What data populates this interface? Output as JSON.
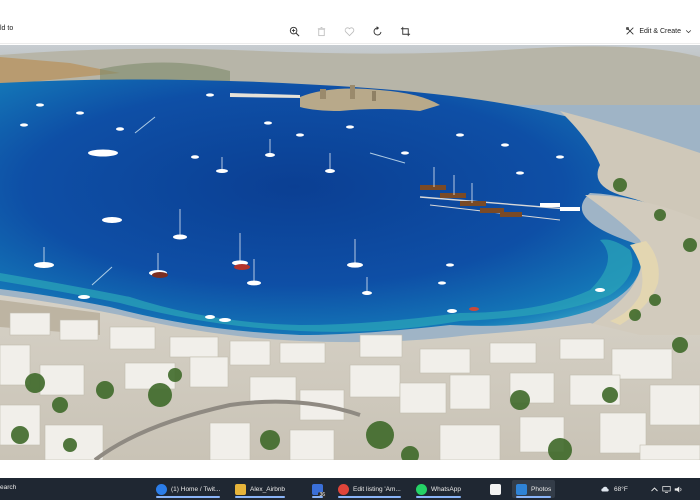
{
  "toolbar": {
    "left_label": "ld to",
    "edit_create_label": "Edit & Create",
    "icons": [
      "zoom-in-icon",
      "delete-icon",
      "favorite-icon",
      "rotate-icon",
      "crop-icon"
    ]
  },
  "photo": {
    "description_icon": "photo-image"
  },
  "taskbar": {
    "search_label": "earch",
    "apps": [
      {
        "label": "(1) Home / Twit..."
      },
      {
        "label": "Alex_Airbnb"
      },
      {
        "label": "36"
      },
      {
        "label": "Edit listing 'Am..."
      },
      {
        "label": "WhatsApp"
      },
      {
        "label": ""
      },
      {
        "label": "Photos"
      }
    ],
    "weather": "68°F",
    "colors": {
      "bg": "#1f2732",
      "active": "#8ab4f8"
    }
  }
}
